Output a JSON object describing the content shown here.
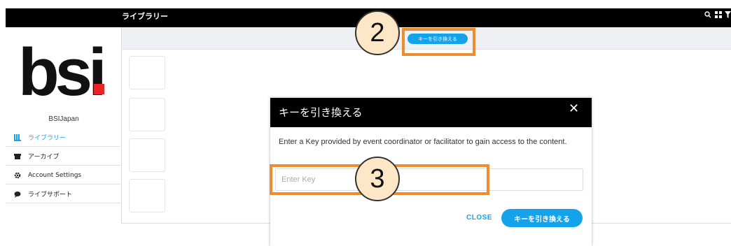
{
  "topbar": {
    "title": "ライブラリー",
    "icons": [
      "search-icon",
      "grid-icon",
      "filter-icon"
    ]
  },
  "sidebar": {
    "org_name": "BSIJapan",
    "logo_text": "bsi",
    "logo_dot_color": "#e8242a",
    "items": [
      {
        "label": "ライブラリー",
        "icon": "library-icon",
        "active": true
      },
      {
        "label": "アーカイブ",
        "icon": "archive-icon",
        "active": false
      },
      {
        "label": "Account Settings",
        "icon": "gear-icon",
        "active": false
      },
      {
        "label": "ライブサポート",
        "icon": "chat-icon",
        "active": false
      }
    ]
  },
  "header": {
    "redeem_button_label": "キーを引き換える"
  },
  "modal": {
    "title": "キーを引き換える",
    "description": "Enter a Key provided by event coordinator or facilitator to gain access to the content.",
    "key_input_placeholder": "Enter Key",
    "key_input_value": "",
    "close_label": "CLOSE",
    "redeem_label": "キーを引き換える"
  },
  "annotations": {
    "step2": "2",
    "step3": "3"
  },
  "colors": {
    "accent": "#14a3ea",
    "highlight": "#ee8c30",
    "badge_fill": "#fde7c6"
  }
}
